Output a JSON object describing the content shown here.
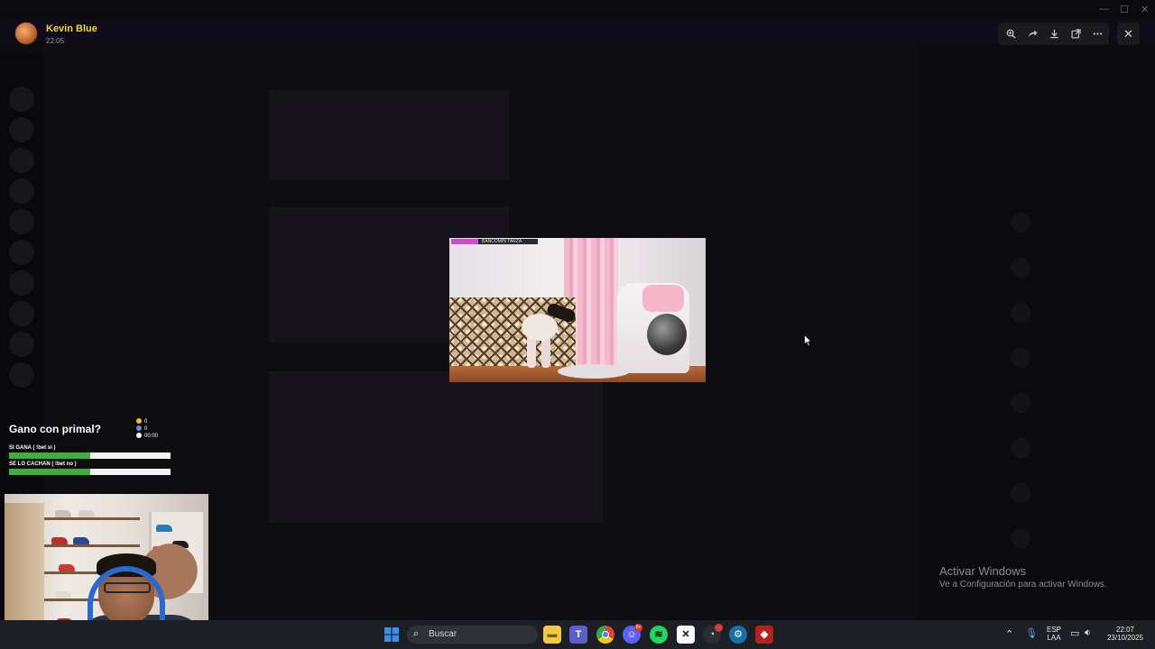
{
  "viewer": {
    "user_name": "Kevin Blue",
    "post_time": "22:05",
    "tools": [
      "zoom-icon",
      "forward-icon",
      "download-icon",
      "open-external-icon",
      "more-icon"
    ],
    "close_icon": "close-icon"
  },
  "photo_hud_text": "BANCOMIN TARZA",
  "poll": {
    "title": "Gano con primal?",
    "stats": [
      {
        "icon": "coin-icon",
        "value": "0",
        "color": "#f0c020"
      },
      {
        "icon": "users-icon",
        "value": "0",
        "color": "#6a8ad8"
      },
      {
        "icon": "clock-icon",
        "value": "00:00",
        "color": "#ffffff"
      }
    ],
    "options": [
      {
        "label": "SI GANA ( !bet si )",
        "fill": 0.5
      },
      {
        "label": "SE LO CACHAN ( !bet no )",
        "fill": 0.5
      }
    ]
  },
  "watermark": {
    "line1": "Activar Windows",
    "line2": "Ve a Configuración para activar Windows."
  },
  "taskbar": {
    "search_placeholder": "Buscar",
    "lang_top": "ESP",
    "lang_bottom": "LAA",
    "time": "22:07",
    "date": "23/10/2025",
    "discord_badge": "9+",
    "apps": [
      "windows-start-icon",
      "file-explorer-icon",
      "teams-icon",
      "chrome-icon",
      "discord-icon",
      "spotify-icon",
      "capcut-icon",
      "steam-speed-icon",
      "steam-icon",
      "dota-icon"
    ],
    "colors": {
      "start": "#3a8ee6",
      "explorer": "#f2c744",
      "teams": "#5b5fc7",
      "chrome": "#e34133",
      "discord": "#5865f2",
      "spotify": "#1ed760",
      "steam": "#1b6fa8",
      "dota": "#b3221d"
    }
  }
}
